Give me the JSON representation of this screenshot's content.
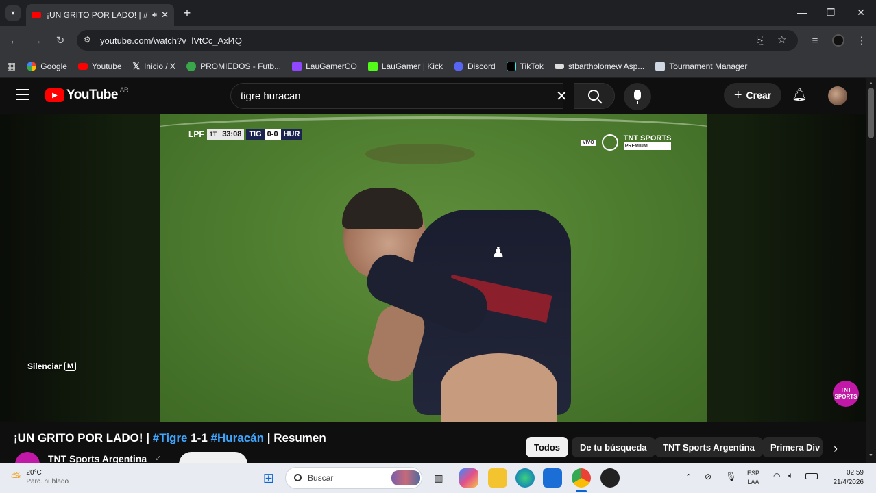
{
  "browser": {
    "tab_title": "¡UN GRITO POR LADO! | #Ti",
    "url": "youtube.com/watch?v=lVtCc_Axl4Q",
    "bookmarks": [
      "Google",
      "Youtube",
      "Inicio / X",
      "PROMIEDOS - Futb...",
      "LauGamerCO",
      "LauGamer | Kick",
      "Discord",
      "TikTok",
      "stbartholomew Asp...",
      "Tournament Manager"
    ]
  },
  "youtube": {
    "logo_text": "YouTube",
    "country": "AR",
    "search_value": "tigre huracan",
    "create_label": "Crear",
    "mute_label": "Silenciar",
    "mute_key": "M",
    "scorebug": {
      "league": "LPF",
      "period": "1T",
      "clock": "33:08",
      "home": "TIG",
      "score": "0-0",
      "away": "HUR"
    },
    "broadcaster": {
      "vivo": "VIVO",
      "brand": "TNT SPORTS",
      "tier": "PREMIUM",
      "watermark": "TNT SPORTS"
    },
    "title_parts": {
      "a": "¡UN GRITO POR LADO! | ",
      "b": "#Tigre",
      "c": " 1-1 ",
      "d": "#Huracán",
      "e": " | Resumen"
    },
    "channel": "TNT Sports Argentina",
    "chips": [
      "Todos",
      "De tu búsqueda",
      "TNT Sports Argentina",
      "Primera Div"
    ]
  },
  "taskbar": {
    "weather_temp": "20°C",
    "weather_desc": "Parc. nublado",
    "search_placeholder": "Buscar",
    "lang1": "ESP",
    "lang2": "LAA",
    "time": "02:59",
    "date": "21/4/2026"
  }
}
